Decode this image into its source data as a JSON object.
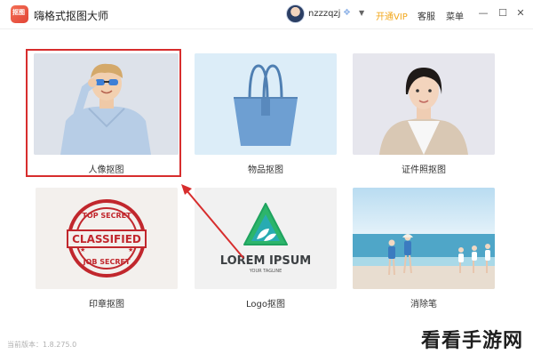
{
  "app": {
    "title": "嗨格式抠图大师",
    "logo_text": "抠图"
  },
  "user": {
    "name": "nzzzqzj",
    "vip_icon": "diamond-icon"
  },
  "toolbar": {
    "open_vip": "开通VIP",
    "service": "客服",
    "menu": "菜单"
  },
  "features": [
    {
      "label": "人像抠图"
    },
    {
      "label": "物品抠图"
    },
    {
      "label": "证件照抠图"
    },
    {
      "label": "印章抠图"
    },
    {
      "label": "Logo抠图"
    },
    {
      "label": "消除笔"
    }
  ],
  "samples": {
    "stamp": {
      "top": "TOP SECRET",
      "main": "CLASSIFIED",
      "bottom": "JOB SECRET"
    },
    "logo": {
      "main": "LOREM IPSUM",
      "sub": "YOUR TAGLINE"
    }
  },
  "footer": {
    "version": "当前版本：1.8.275.0"
  },
  "watermark": "看看手游网",
  "colors": {
    "highlight": "#d72d2d",
    "vip": "#f2a71b",
    "logo_green": "#2db56b"
  }
}
